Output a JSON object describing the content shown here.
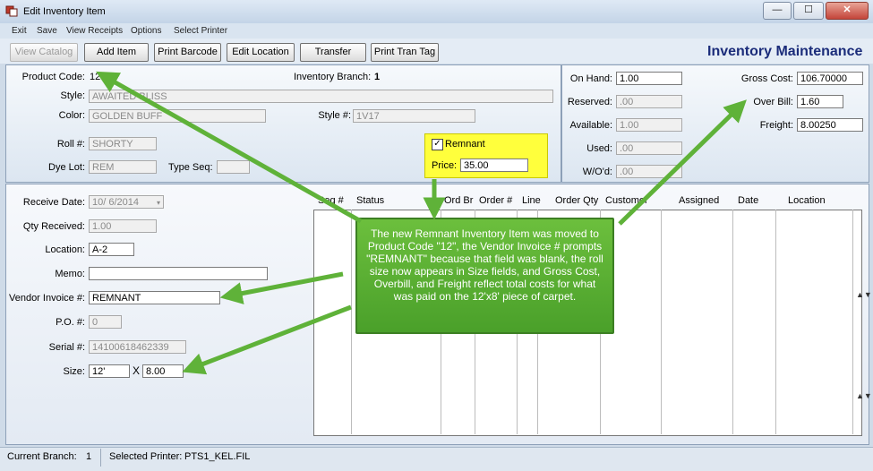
{
  "window": {
    "title": "Edit Inventory Item",
    "close_symbol": "✕",
    "minimize_symbol": "—",
    "maximize_symbol": "☐"
  },
  "menu": [
    "Exit",
    "Save",
    "View Receipts",
    "Options",
    "Select Printer"
  ],
  "toolbar": {
    "buttons": [
      "View Catalog",
      "Add Item",
      "Print Barcode",
      "Edit Location",
      "Transfer",
      "Print Tran Tag"
    ],
    "title": "Inventory Maintenance"
  },
  "item": {
    "product_code_label": "Product Code:",
    "product_code": "12",
    "branch_label": "Inventory Branch:",
    "branch": "1",
    "style_label": "Style:",
    "style": "AWAITED BLISS",
    "color_label": "Color:",
    "color": "GOLDEN BUFF",
    "style_no_label": "Style #:",
    "style_no": "1V17",
    "roll_label": "Roll #:",
    "roll": "SHORTY",
    "dye_lot_label": "Dye Lot:",
    "dye_lot": "REM",
    "type_seq_label": "Type Seq:",
    "type_seq": "",
    "remnant_label": "Remnant",
    "remnant_check": "✓",
    "price_label": "Price:",
    "price": "35.00"
  },
  "stock": {
    "on_hand_label": "On Hand:",
    "on_hand": "1.00",
    "reserved_label": "Reserved:",
    "reserved": ".00",
    "available_label": "Available:",
    "available": "1.00",
    "used_label": "Used:",
    "used": ".00",
    "wod_label": "W/O'd:",
    "wod": ".00",
    "gross_cost_label": "Gross Cost:",
    "gross_cost": "106.70000",
    "over_bill_label": "Over Bill:",
    "over_bill": "1.60",
    "freight_label": "Freight:",
    "freight": "8.00250"
  },
  "receipt": {
    "receive_date_label": "Receive Date:",
    "receive_date": "10/ 6/2014",
    "qty_received_label": "Qty Received:",
    "qty_received": "1.00",
    "location_label": "Location:",
    "location": "A-2",
    "memo_label": "Memo:",
    "memo": "",
    "vendor_invoice_label": "Vendor Invoice #:",
    "vendor_invoice": "REMNANT",
    "po_label": "P.O. #:",
    "po": "0",
    "serial_label": "Serial #:",
    "serial": "14100618462339",
    "size_label": "Size:",
    "size_w": "12'",
    "size_x": "X",
    "size_l": "8.00"
  },
  "grid": {
    "columns": [
      "Seq #",
      "Status",
      "Ord Br",
      "Order #",
      "Line",
      "Order Qty",
      "Customer",
      "Assigned",
      "Date",
      "Location"
    ]
  },
  "callout": {
    "text": "The new Remnant Inventory Item was moved to Product Code \"12\", the Vendor Invoice # prompts \"REMNANT\" because that field was blank, the roll size now appears in Size fields, and Gross Cost, Overbill, and Freight reflect total costs for what was paid on the 12'x8' piece of carpet."
  },
  "status": {
    "branch_label": "Current Branch:",
    "branch": "1",
    "printer_label": "Selected Printer:",
    "printer": "PTS1_KEL.FIL"
  },
  "colors": {
    "callout": "#4aa02a",
    "highlight": "#ffff3c",
    "title": "#1b2c7a"
  }
}
